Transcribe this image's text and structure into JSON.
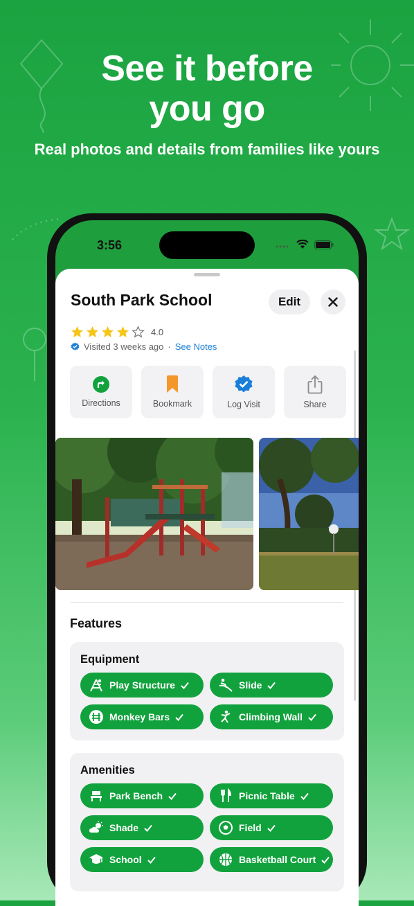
{
  "headline": {
    "line1": "See it before",
    "line2": "you go"
  },
  "subline": "Real photos and details from families like yours",
  "status_bar": {
    "time": "3:56"
  },
  "place": {
    "name": "South Park School",
    "edit_label": "Edit",
    "rating": 4.0,
    "rating_text": "4.0",
    "visited_text": "Visited 3 weeks ago",
    "separator": "·",
    "see_notes_label": "See Notes"
  },
  "actions": [
    {
      "label": "Directions",
      "icon": "directions-icon"
    },
    {
      "label": "Bookmark",
      "icon": "bookmark-icon"
    },
    {
      "label": "Log Visit",
      "icon": "verified-badge-icon"
    },
    {
      "label": "Share",
      "icon": "share-icon"
    }
  ],
  "features": {
    "title": "Features",
    "equipment": {
      "title": "Equipment",
      "items": [
        {
          "label": "Play Structure",
          "icon": "play-structure-icon",
          "checked": true
        },
        {
          "label": "Slide",
          "icon": "slide-icon",
          "checked": true
        },
        {
          "label": "Monkey Bars",
          "icon": "monkey-bars-icon",
          "checked": true
        },
        {
          "label": "Climbing Wall",
          "icon": "climbing-icon",
          "checked": true
        }
      ]
    },
    "amenities": {
      "title": "Amenities",
      "items": [
        {
          "label": "Park Bench",
          "icon": "bench-icon",
          "checked": true
        },
        {
          "label": "Picnic Table",
          "icon": "fork-knife-icon",
          "checked": true
        },
        {
          "label": "Shade",
          "icon": "cloud-sun-icon",
          "checked": true
        },
        {
          "label": "Field",
          "icon": "soccer-ball-icon",
          "checked": true
        },
        {
          "label": "School",
          "icon": "graduation-cap-icon",
          "checked": true
        },
        {
          "label": "Basketball Court",
          "icon": "basketball-icon",
          "checked": true
        }
      ]
    }
  },
  "colors": {
    "brand_green": "#1aa340",
    "chip_green": "#12a23d",
    "link_blue": "#1a7fd8",
    "star_gold": "#f5c518"
  }
}
